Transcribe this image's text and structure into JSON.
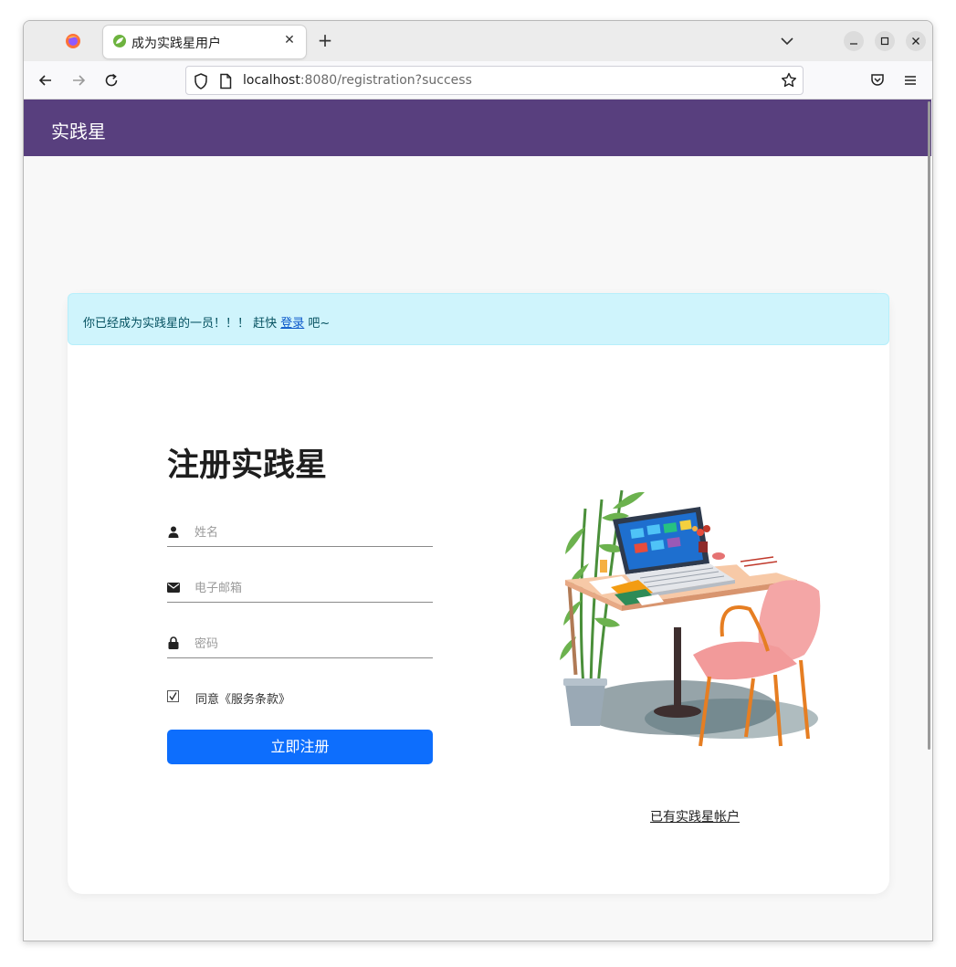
{
  "browser": {
    "tab_title": "成为实践星用户",
    "url_host": "localhost",
    "url_rest": ":8080/registration?success"
  },
  "site": {
    "brand": "实践星"
  },
  "alert": {
    "message": "你已经成为实践星的一员！！！ 赶快 ",
    "link_text": "登录",
    "suffix": " 吧~"
  },
  "form": {
    "title": "注册实践星",
    "name_placeholder": "姓名",
    "email_placeholder": "电子邮箱",
    "password_placeholder": "密码",
    "agree_label": "同意《服务条款》",
    "submit_label": "立即注册"
  },
  "existing_account_link": "已有实践星帐户",
  "colors": {
    "header": "#583f7e",
    "primary": "#0d6efd",
    "alert_bg": "#cff4fc"
  }
}
